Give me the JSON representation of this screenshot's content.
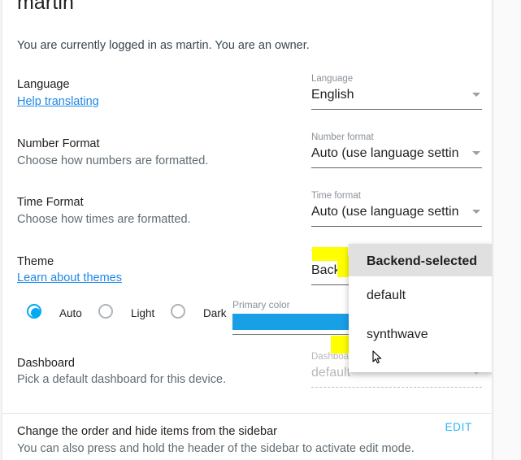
{
  "card": {
    "title": "martin",
    "intro": "You are currently logged in as martin. You are an owner."
  },
  "rows": [
    {
      "label": "Language",
      "link": "Help translating",
      "field": {
        "label": "Language",
        "value": "English"
      }
    },
    {
      "label": "Number Format",
      "sub": "Choose how numbers are formatted.",
      "field": {
        "label": "Number format",
        "value": "Auto (use language settin"
      }
    },
    {
      "label": "Time Format",
      "sub": "Choose how times are formatted.",
      "field": {
        "label": "Time format",
        "value": "Auto (use language settin"
      }
    },
    {
      "label": "Theme",
      "link": "Learn about themes",
      "field": {
        "label": "Theme",
        "value": "Backe"
      }
    },
    {
      "label": "Dashboard",
      "sub": "Pick a default dashboard for this device.",
      "field": {
        "label": "Dashboa",
        "value": "default"
      }
    }
  ],
  "theme_mode": {
    "options": [
      {
        "label": "Auto",
        "selected": true
      },
      {
        "label": "Light",
        "selected": false
      },
      {
        "label": "Dark",
        "selected": false
      }
    ]
  },
  "primary_color": {
    "label": "Primary color",
    "swatch_hex": "#199fe6"
  },
  "theme_menu": {
    "items": [
      {
        "label": "Backend-selected",
        "selected": true
      },
      {
        "label": "default",
        "selected": false
      },
      {
        "label": "synthwave",
        "selected": false
      }
    ]
  },
  "sidebar_section": {
    "title": "Change the order and hide items from the sidebar",
    "sub": "You can also press and hold the header of the sidebar to activate edit mode.",
    "edit_label": "EDIT"
  },
  "colors": {
    "accent": "#03a9f4",
    "link": "#1e88e5",
    "highlight": "#ffff00",
    "menu_selected_bg": "#e0e0e0"
  }
}
